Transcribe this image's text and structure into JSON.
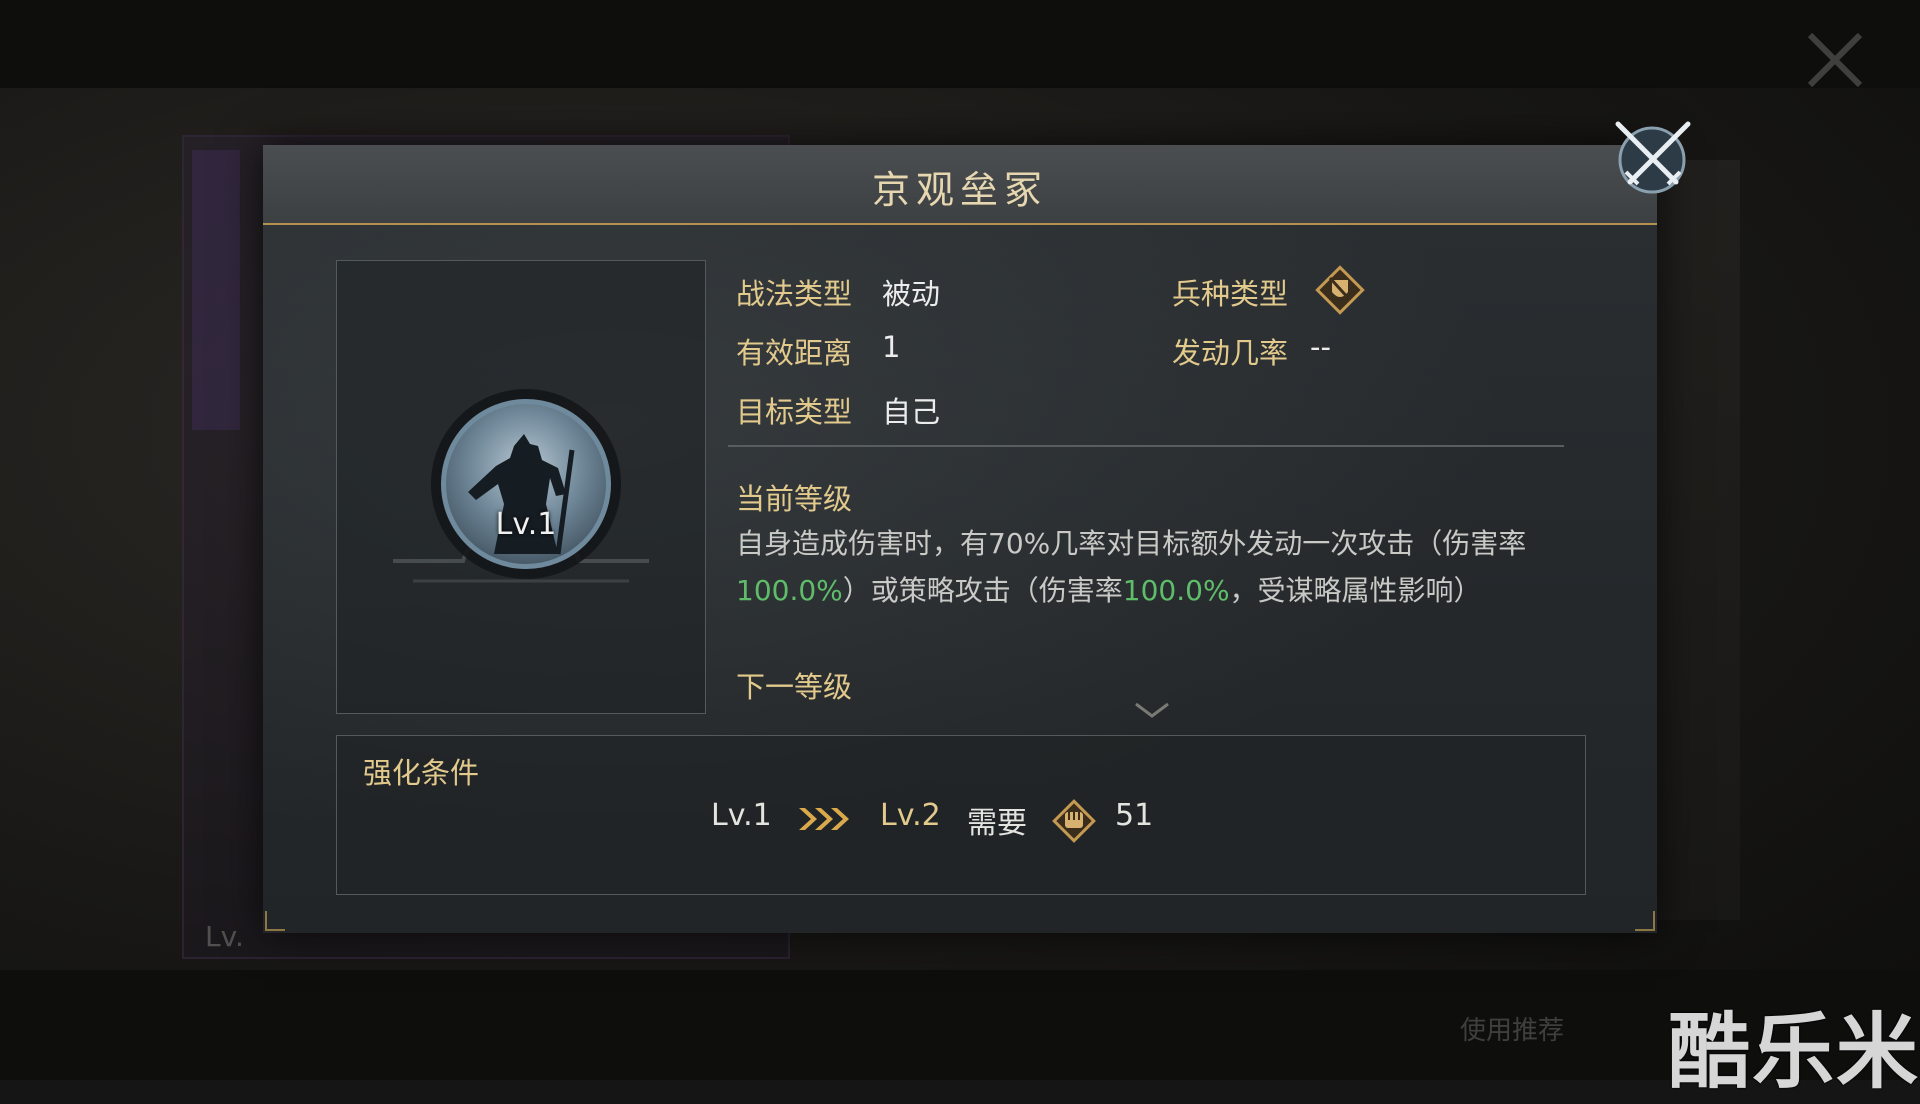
{
  "dialog": {
    "title": "京观垒冢"
  },
  "portrait": {
    "level_badge": "Lv.1"
  },
  "info": {
    "tactic_type_label": "战法类型",
    "tactic_type_value": "被动",
    "troop_type_label": "兵种类型",
    "troop_type_icon": "troop-shield-icon",
    "range_label": "有效距离",
    "range_value": "1",
    "trigger_rate_label": "发动几率",
    "trigger_rate_value": "--",
    "target_label": "目标类型",
    "target_value": "自己"
  },
  "current_level": {
    "heading": "当前等级",
    "desc_part1": "自身造成伤害时，有70%几率对目标额外发动一次攻击（伤害率",
    "damage_rate_1": "100.0%",
    "desc_part2": "）或策略攻击（伤害率",
    "damage_rate_2": "100.0%",
    "desc_part3": "，受谋略属性影响）"
  },
  "next_level": {
    "heading": "下一等级"
  },
  "upgrade": {
    "title": "强化条件",
    "from_level": "Lv.1",
    "to_level": "Lv.2",
    "require_label": "需要",
    "cost_icon": "fist-token-icon",
    "cost_value": "51"
  },
  "background": {
    "card_level": "Lv.",
    "recommend_text": "使用推荐"
  },
  "watermark": {
    "text": "酷乐米"
  },
  "colors": {
    "gold_label": "#e2c98c",
    "highlight_green": "#5fbd6a",
    "header_line": "#b39250"
  }
}
